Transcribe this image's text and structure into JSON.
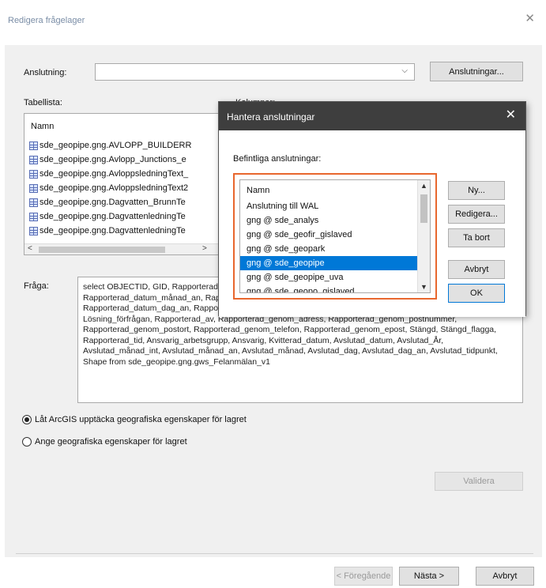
{
  "window": {
    "title": "Redigera frågelager"
  },
  "connection": {
    "label": "Anslutning:",
    "value": "",
    "connections_button": "Anslutningar..."
  },
  "tables": {
    "label": "Tabellista:",
    "header": "Namn",
    "items": [
      "sde_geopipe.gng.AVLOPP_BUILDERR",
      "sde_geopipe.gng.Avlopp_Junctions_e",
      "sde_geopipe.gng.AvloppsledningText_",
      "sde_geopipe.gng.AvloppsledningText2",
      "sde_geopipe.gng.Dagvatten_BrunnTe",
      "sde_geopipe.gng.DagvattenledningTe",
      "sde_geopipe.gng.DagvattenledningTe"
    ]
  },
  "columns": {
    "label": "Kolumner:"
  },
  "query": {
    "label": "Fråga:",
    "text": "select OBJECTID, GID, Rapporterad_datum, Rapporterad_datum_år, Rapporterad_datum_månad_int, Rapporterad_datum_månad_an, Rapporterad_datum_månad, Rapporterad_datum_dag, Rapporterad_datum_dag_an, Rapporterad_tidpunkt, Beskrivning, Adress, Fastighet, Platsbeskrivning, Lösning_förfrågan, Rapporterad_av, Rapporterad_genom_adress, Rapporterad_genom_postnummer, Rapporterad_genom_postort, Rapporterad_genom_telefon, Rapporterad_genom_epost, Stängd, Stängd_flagga, Rapporterad_tid, Ansvarig_arbetsgrupp, Ansvarig, Kvitterad_datum, Avslutad_datum, Avslutad_År, Avslutad_månad_int, Avslutad_månad_an, Avslutad_månad, Avslutad_dag, Avslutad_dag_an, Avslutad_tidpunkt, Shape from sde_geopipe.gng.gws_Felanmälan_v1"
  },
  "geometry": {
    "option_auto": "Låt ArcGIS upptäcka geografiska egenskaper för lagret",
    "option_manual": "Ange geografiska egenskaper för lagret",
    "selected": "option_auto"
  },
  "buttons": {
    "validate": "Validera",
    "previous": "< Föregående",
    "next": "Nästa >",
    "cancel": "Avbryt"
  },
  "modal": {
    "title": "Hantera anslutningar",
    "existing_label": "Befintliga anslutningar:",
    "list_header": "Namn",
    "items": [
      "Anslutning till WAL",
      "gng @ sde_analys",
      "gng @ sde_geofir_gislaved",
      "gng @ sde_geopark",
      "gng @ sde_geopipe",
      "gng @ sde_geopipe_uva",
      "gng @ sde_geopo_gislaved"
    ],
    "selected_index": 4,
    "buttons": {
      "new": "Ny...",
      "edit": "Redigera...",
      "delete": "Ta bort",
      "cancel": "Avbryt",
      "ok": "OK"
    },
    "colors": {
      "titlebar": "#3e3e3e",
      "highlight_frame": "#e8672e",
      "selection": "#0078d7"
    }
  }
}
